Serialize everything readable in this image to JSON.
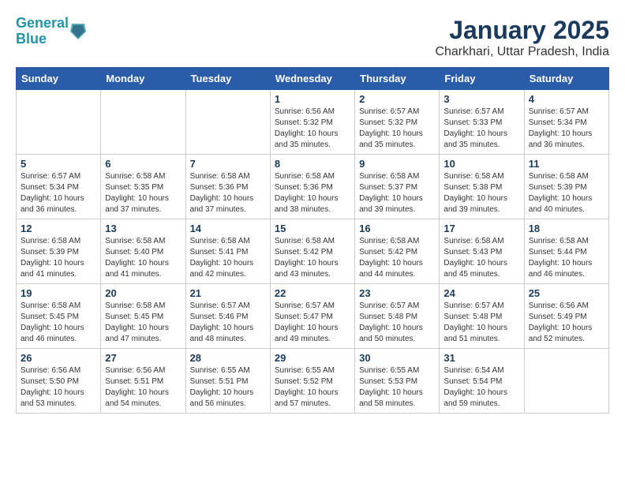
{
  "logo": {
    "line1": "General",
    "line2": "Blue"
  },
  "title": "January 2025",
  "subtitle": "Charkhari, Uttar Pradesh, India",
  "headers": [
    "Sunday",
    "Monday",
    "Tuesday",
    "Wednesday",
    "Thursday",
    "Friday",
    "Saturday"
  ],
  "weeks": [
    [
      {
        "day": "",
        "info": ""
      },
      {
        "day": "",
        "info": ""
      },
      {
        "day": "",
        "info": ""
      },
      {
        "day": "1",
        "info": "Sunrise: 6:56 AM\nSunset: 5:32 PM\nDaylight: 10 hours\nand 35 minutes."
      },
      {
        "day": "2",
        "info": "Sunrise: 6:57 AM\nSunset: 5:32 PM\nDaylight: 10 hours\nand 35 minutes."
      },
      {
        "day": "3",
        "info": "Sunrise: 6:57 AM\nSunset: 5:33 PM\nDaylight: 10 hours\nand 35 minutes."
      },
      {
        "day": "4",
        "info": "Sunrise: 6:57 AM\nSunset: 5:34 PM\nDaylight: 10 hours\nand 36 minutes."
      }
    ],
    [
      {
        "day": "5",
        "info": "Sunrise: 6:57 AM\nSunset: 5:34 PM\nDaylight: 10 hours\nand 36 minutes."
      },
      {
        "day": "6",
        "info": "Sunrise: 6:58 AM\nSunset: 5:35 PM\nDaylight: 10 hours\nand 37 minutes."
      },
      {
        "day": "7",
        "info": "Sunrise: 6:58 AM\nSunset: 5:36 PM\nDaylight: 10 hours\nand 37 minutes."
      },
      {
        "day": "8",
        "info": "Sunrise: 6:58 AM\nSunset: 5:36 PM\nDaylight: 10 hours\nand 38 minutes."
      },
      {
        "day": "9",
        "info": "Sunrise: 6:58 AM\nSunset: 5:37 PM\nDaylight: 10 hours\nand 39 minutes."
      },
      {
        "day": "10",
        "info": "Sunrise: 6:58 AM\nSunset: 5:38 PM\nDaylight: 10 hours\nand 39 minutes."
      },
      {
        "day": "11",
        "info": "Sunrise: 6:58 AM\nSunset: 5:39 PM\nDaylight: 10 hours\nand 40 minutes."
      }
    ],
    [
      {
        "day": "12",
        "info": "Sunrise: 6:58 AM\nSunset: 5:39 PM\nDaylight: 10 hours\nand 41 minutes."
      },
      {
        "day": "13",
        "info": "Sunrise: 6:58 AM\nSunset: 5:40 PM\nDaylight: 10 hours\nand 41 minutes."
      },
      {
        "day": "14",
        "info": "Sunrise: 6:58 AM\nSunset: 5:41 PM\nDaylight: 10 hours\nand 42 minutes."
      },
      {
        "day": "15",
        "info": "Sunrise: 6:58 AM\nSunset: 5:42 PM\nDaylight: 10 hours\nand 43 minutes."
      },
      {
        "day": "16",
        "info": "Sunrise: 6:58 AM\nSunset: 5:42 PM\nDaylight: 10 hours\nand 44 minutes."
      },
      {
        "day": "17",
        "info": "Sunrise: 6:58 AM\nSunset: 5:43 PM\nDaylight: 10 hours\nand 45 minutes."
      },
      {
        "day": "18",
        "info": "Sunrise: 6:58 AM\nSunset: 5:44 PM\nDaylight: 10 hours\nand 46 minutes."
      }
    ],
    [
      {
        "day": "19",
        "info": "Sunrise: 6:58 AM\nSunset: 5:45 PM\nDaylight: 10 hours\nand 46 minutes."
      },
      {
        "day": "20",
        "info": "Sunrise: 6:58 AM\nSunset: 5:45 PM\nDaylight: 10 hours\nand 47 minutes."
      },
      {
        "day": "21",
        "info": "Sunrise: 6:57 AM\nSunset: 5:46 PM\nDaylight: 10 hours\nand 48 minutes."
      },
      {
        "day": "22",
        "info": "Sunrise: 6:57 AM\nSunset: 5:47 PM\nDaylight: 10 hours\nand 49 minutes."
      },
      {
        "day": "23",
        "info": "Sunrise: 6:57 AM\nSunset: 5:48 PM\nDaylight: 10 hours\nand 50 minutes."
      },
      {
        "day": "24",
        "info": "Sunrise: 6:57 AM\nSunset: 5:48 PM\nDaylight: 10 hours\nand 51 minutes."
      },
      {
        "day": "25",
        "info": "Sunrise: 6:56 AM\nSunset: 5:49 PM\nDaylight: 10 hours\nand 52 minutes."
      }
    ],
    [
      {
        "day": "26",
        "info": "Sunrise: 6:56 AM\nSunset: 5:50 PM\nDaylight: 10 hours\nand 53 minutes."
      },
      {
        "day": "27",
        "info": "Sunrise: 6:56 AM\nSunset: 5:51 PM\nDaylight: 10 hours\nand 54 minutes."
      },
      {
        "day": "28",
        "info": "Sunrise: 6:55 AM\nSunset: 5:51 PM\nDaylight: 10 hours\nand 56 minutes."
      },
      {
        "day": "29",
        "info": "Sunrise: 6:55 AM\nSunset: 5:52 PM\nDaylight: 10 hours\nand 57 minutes."
      },
      {
        "day": "30",
        "info": "Sunrise: 6:55 AM\nSunset: 5:53 PM\nDaylight: 10 hours\nand 58 minutes."
      },
      {
        "day": "31",
        "info": "Sunrise: 6:54 AM\nSunset: 5:54 PM\nDaylight: 10 hours\nand 59 minutes."
      },
      {
        "day": "",
        "info": ""
      }
    ]
  ]
}
